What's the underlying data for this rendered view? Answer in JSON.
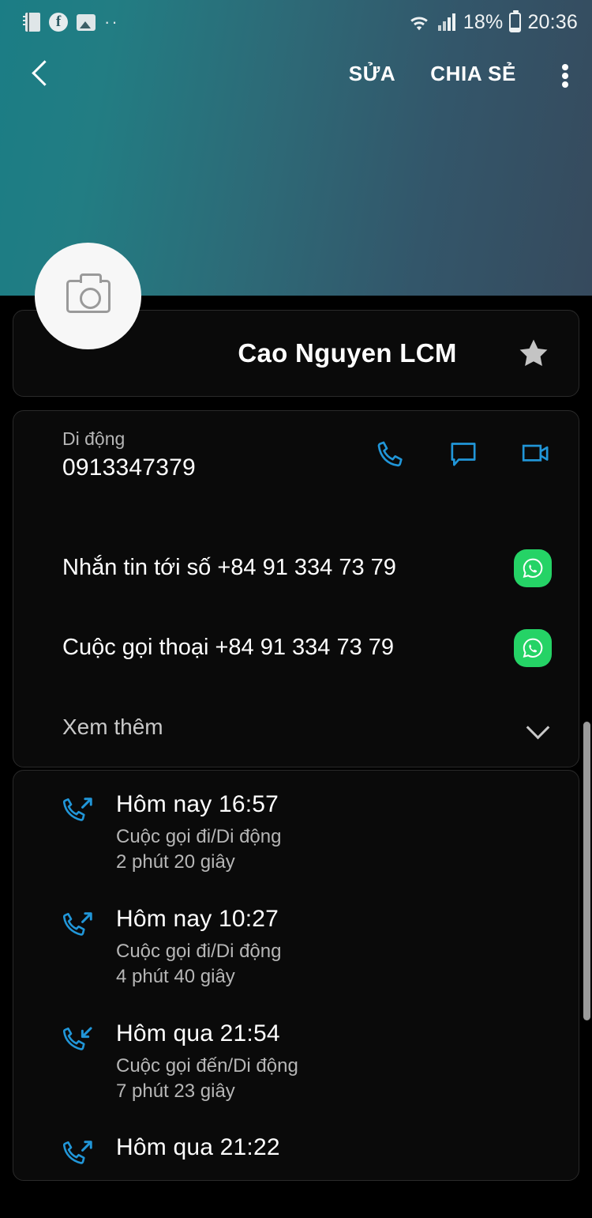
{
  "statusbar": {
    "icons": [
      "contacts-icon",
      "facebook-icon",
      "image-icon",
      "more-notifications-icon"
    ],
    "wifi": "wifi-icon",
    "signal": "signal-icon",
    "battery_percent": "18%",
    "battery": "battery-icon",
    "time": "20:36"
  },
  "appbar": {
    "back": "back-icon",
    "edit_label": "SỬA",
    "share_label": "CHIA SẺ",
    "overflow": "overflow-menu-icon"
  },
  "contact": {
    "name": "Cao Nguyen LCM",
    "avatar": "camera-placeholder-icon",
    "favorite": "star-icon"
  },
  "info": {
    "number_label": "Di động",
    "number_value": "0913347379",
    "actions": [
      "call-icon",
      "message-icon",
      "video-call-icon"
    ],
    "whatsapp_message": "Nhắn tin tới số +84 91 334 73 79",
    "whatsapp_call": "Cuộc gọi thoại +84 91 334 73 79",
    "see_more": "Xem thêm"
  },
  "calls": [
    {
      "direction": "outgoing",
      "title": "Hôm nay 16:57",
      "type": "Cuộc gọi đi/Di động",
      "duration": "2 phút 20 giây"
    },
    {
      "direction": "outgoing",
      "title": "Hôm nay 10:27",
      "type": "Cuộc gọi đi/Di động",
      "duration": "4 phút 40 giây"
    },
    {
      "direction": "incoming",
      "title": "Hôm qua 21:54",
      "type": "Cuộc gọi đến/Di động",
      "duration": "7 phút 23 giây"
    },
    {
      "direction": "outgoing",
      "title": "Hôm qua 21:22",
      "type": "",
      "duration": ""
    }
  ],
  "colors": {
    "header_start": "#1b7d85",
    "header_end": "#364a5d",
    "accent_blue": "#2196d8",
    "whatsapp_green": "#25D366",
    "card_bg": "#0a0a0a",
    "star": "#c4c4c4"
  }
}
